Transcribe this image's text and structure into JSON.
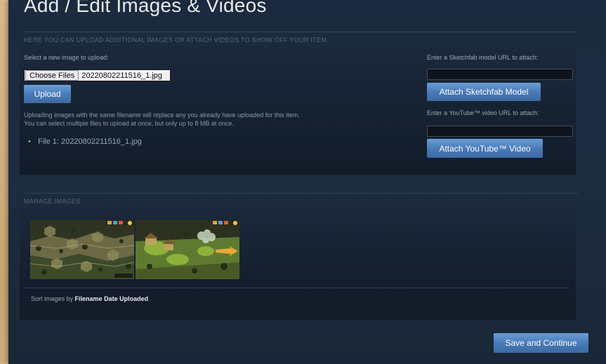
{
  "page": {
    "title": "Add / Edit Images & Videos"
  },
  "upload_section": {
    "heading": "HERE YOU CAN UPLOAD ADDITIONAL IMAGES OR ATTACH VIDEOS TO SHOW OFF YOUR ITEM.",
    "select_label": "Select a new image to upload:",
    "choose_files_label": "Choose Files",
    "selected_filename": "20220802211516_1.jpg",
    "upload_button": "Upload",
    "hint_line1": "Uploading images with the same filename will replace any you already have uploaded for this item.",
    "hint_line2": "You can select multiple files to upload at once, but only up to 8 MB at once.",
    "file_list": [
      {
        "label": "File 1: 20220802211516_1.jpg"
      }
    ]
  },
  "attach_section": {
    "sketchfab_label": "Enter a Sketchfab model URL to attach:",
    "sketchfab_value": "",
    "sketchfab_button": "Attach Sketchfab Model",
    "youtube_label": "Enter a YouTube™ video URL to attach:",
    "youtube_value": "",
    "youtube_button": "Attach YouTube™ Video"
  },
  "manage_section": {
    "heading": "MANAGE IMAGES",
    "thumbnails": [
      {
        "name": "screenshot-thumbnail-1"
      },
      {
        "name": "screenshot-thumbnail-2"
      }
    ],
    "sort_prefix": "Sort images by",
    "sort_options": [
      "Filename",
      "Date Uploaded"
    ]
  },
  "footer": {
    "save_button": "Save and Continue"
  },
  "colors": {
    "button_blue": "#4a7bb8",
    "panel_bg": "#1b2a3e",
    "text_muted": "#9aa7b5"
  }
}
